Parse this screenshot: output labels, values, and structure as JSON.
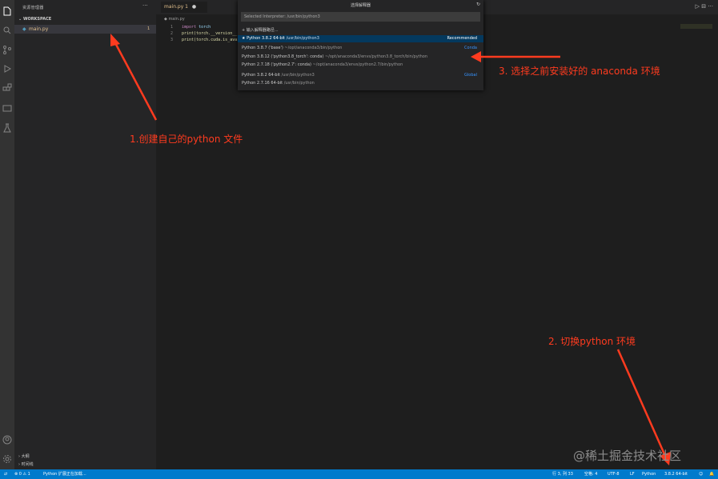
{
  "sidebar": {
    "title": "资源管理器",
    "more": "···",
    "section": "WORKSPACE",
    "file": {
      "name": "main.py",
      "badge": "1"
    },
    "bottom_sections": [
      "大纲",
      "时间线"
    ]
  },
  "editor": {
    "tab": {
      "label": "main.py 1",
      "close": "●"
    },
    "actions": "▷ ⊟ ···",
    "breadcrumb": "main.py",
    "code": [
      {
        "num": "1",
        "kw": "import",
        "rest": " torch"
      },
      {
        "num": "2",
        "kw": "",
        "rest": "print(torch.__version__)"
      },
      {
        "num": "3",
        "kw": "",
        "rest": "print(torch.cuda.is_available())"
      }
    ]
  },
  "quickpick": {
    "title": "选择解释器",
    "refresh": "↻",
    "input_value": "Selected Interpreter: /usr/bin/python3",
    "items": [
      {
        "label": "+ 输入解释器路径...",
        "detail": "",
        "tag": ""
      },
      {
        "label": "★ Python 3.8.2 64-bit",
        "detail": " /usr/bin/python3",
        "tag": "Recommended"
      },
      {
        "label": "Python 3.8.7 ('base')",
        "detail": " ~/opt/anaconda3/bin/python",
        "tag": "Conda"
      },
      {
        "label": "Python 3.8.12 ('python3.8_torch': conda)",
        "detail": " ~/opt/anaconda3/envs/python3.8_torch/bin/python",
        "tag": ""
      },
      {
        "label": "Python 2.7.18 ('python2.7': conda)",
        "detail": " ~/opt/anaconda3/envs/python2.7/bin/python",
        "tag": ""
      },
      {
        "label": "Python 3.8.2 64-bit",
        "detail": " /usr/bin/python3",
        "tag": "Global"
      },
      {
        "label": "Python 2.7.16 64-bit",
        "detail": " /usr/bin/python",
        "tag": ""
      }
    ]
  },
  "annotations": {
    "step1": "1.创建自己的python 文件",
    "step2": "2. 切换python 环境",
    "step3": "3. 选择之前安装好的 anaconda 环境"
  },
  "watermark": "@稀土掘金技术社区",
  "status": {
    "remote": "⇄",
    "problems": "⊗ 0 ⚠ 1",
    "python_loading": "Python 扩展正在加载...",
    "cursor": "行 3, 列 33",
    "spaces": "空格: 4",
    "encoding": "UTF-8",
    "eol": "LF",
    "language": "Python",
    "interpreter": "3.8.2 64-bit",
    "feedback": "☺",
    "bell": "🔔"
  },
  "colors": {
    "status_bar": "#007acc",
    "annotation": "#ff3b1f",
    "quickpick_active": "#04395e"
  }
}
